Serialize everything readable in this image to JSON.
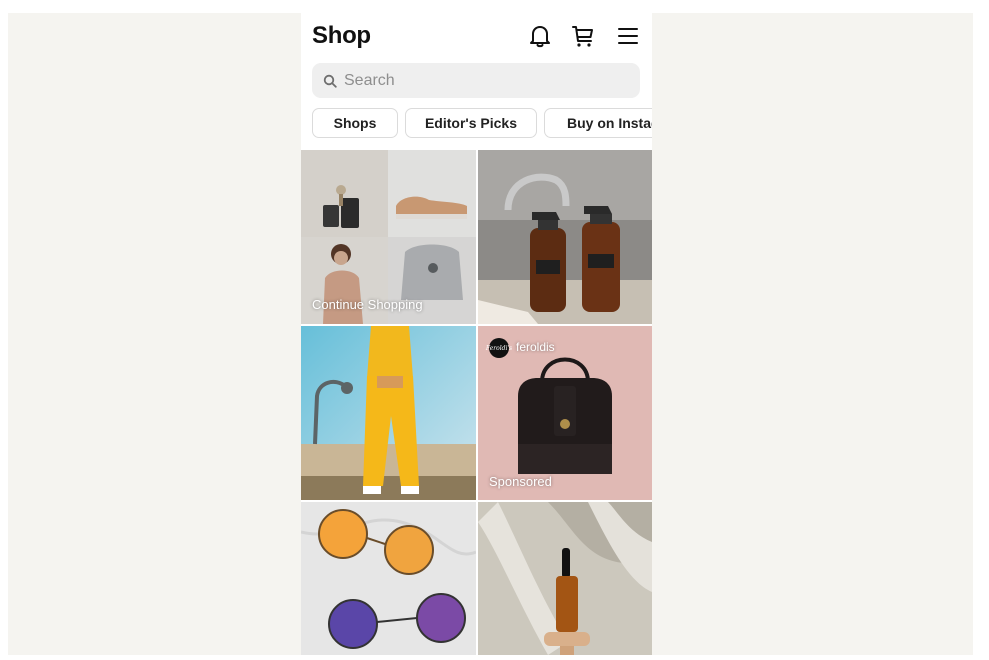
{
  "header": {
    "title": "Shop",
    "icons": [
      "bell-icon",
      "cart-icon",
      "menu-icon"
    ]
  },
  "search": {
    "placeholder": "Search"
  },
  "chips": [
    {
      "label": "Shops"
    },
    {
      "label": "Editor's Picks"
    },
    {
      "label": "Buy on Instag"
    }
  ],
  "tiles": {
    "continue": {
      "label": "Continue Shopping"
    },
    "sprays": {},
    "yellow_outfit": {},
    "bag": {
      "account": "feroldis",
      "badge_text": "Feroldi's",
      "sponsored": "Sponsored"
    },
    "sunglasses": {},
    "dropper": {}
  },
  "colors": {
    "canvas": "#f5f4f0",
    "chip_border": "#dbdbdb",
    "search_bg": "#efefef"
  }
}
